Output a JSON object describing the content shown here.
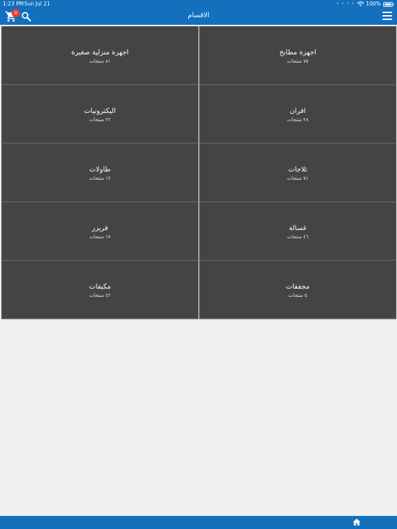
{
  "status_bar": {
    "time": "1:23 PM",
    "date": "Sun Jul 21",
    "battery": "100%"
  },
  "header": {
    "title": "الاقسام",
    "cart_count": "0"
  },
  "categories": [
    {
      "name": "اجهزة مطابخ",
      "count": "٧٥ منتجات"
    },
    {
      "name": "اجهزة منزلية صغيرة",
      "count": "٨١ منتجات"
    },
    {
      "name": "افران",
      "count": "٢٨ منتجات"
    },
    {
      "name": "اليكترونيات",
      "count": "٢٢ منتجات"
    },
    {
      "name": "ثلاجات",
      "count": "٧١ منتجات"
    },
    {
      "name": "طاولات",
      "count": "١٢ منتجات"
    },
    {
      "name": "غسالة",
      "count": "٤٦ منتجات"
    },
    {
      "name": "فريزر",
      "count": "١٧ منتجات"
    },
    {
      "name": "مجففات",
      "count": "٥ منتجات"
    },
    {
      "name": "مكيفات",
      "count": "٤٢ منتجات"
    }
  ],
  "colors": {
    "brand_blue": "#1270bd",
    "tile_bg": "#444444",
    "page_bg": "#f0f0f0",
    "badge_red": "#e53935"
  },
  "icons": [
    "cart-icon",
    "search-icon",
    "menu-icon",
    "home-icon",
    "wifi-icon",
    "battery-icon"
  ]
}
